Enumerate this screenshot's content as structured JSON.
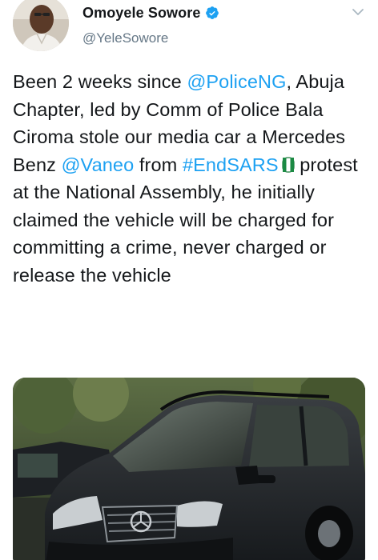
{
  "author": {
    "display_name": "Omoyele Sowore",
    "handle": "@YeleSowore",
    "verified": true
  },
  "tweet": {
    "text_parts": [
      {
        "type": "text",
        "value": "Been 2 weeks since "
      },
      {
        "type": "mention",
        "value": "@PoliceNG"
      },
      {
        "type": "text",
        "value": ", Abuja Chapter, led by Comm of Police Bala Ciroma stole our media car a Mercedes Benz "
      },
      {
        "type": "mention",
        "value": "@Vaneo"
      },
      {
        "type": "text",
        "value": " from "
      },
      {
        "type": "hashtag",
        "value": "#EndSARS"
      },
      {
        "type": "text",
        "value": " protest at the National Assembly, he initially claimed the vehicle will be charged for committing a crime, never charged or release the vehicle"
      }
    ],
    "emoji": "nigeria-flag-emoji"
  },
  "icons": {
    "verified": "verified-badge-icon",
    "menu": "chevron-down-icon"
  },
  "colors": {
    "link": "#1da1f2",
    "text": "#14171a",
    "secondary": "#657786"
  }
}
